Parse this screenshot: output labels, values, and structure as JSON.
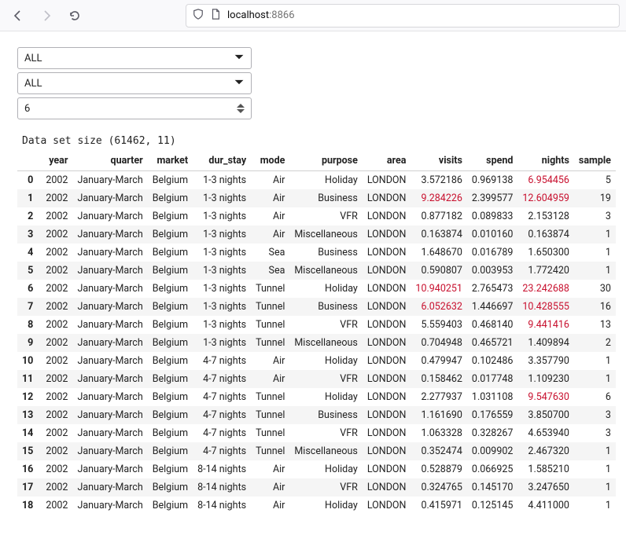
{
  "url": {
    "host": "localhost",
    "port": ":8866"
  },
  "controls": {
    "select1": "ALL",
    "select2": "ALL",
    "spinner": "6"
  },
  "size_label": "Data set size (61462, 11)",
  "columns": [
    "year",
    "quarter",
    "market",
    "dur_stay",
    "mode",
    "purpose",
    "area",
    "visits",
    "spend",
    "nights",
    "sample"
  ],
  "red_cells": {
    "0": [
      "nights"
    ],
    "1": [
      "visits",
      "nights"
    ],
    "6": [
      "visits",
      "nights"
    ],
    "7": [
      "visits",
      "nights"
    ],
    "8": [
      "nights"
    ],
    "12": [
      "nights"
    ]
  },
  "rows": [
    {
      "idx": 0,
      "year": 2002,
      "quarter": "January-March",
      "market": "Belgium",
      "dur_stay": "1-3 nights",
      "mode": "Air",
      "purpose": "Holiday",
      "area": "LONDON",
      "visits": "3.572186",
      "spend": "0.969138",
      "nights": "6.954456",
      "sample": 5
    },
    {
      "idx": 1,
      "year": 2002,
      "quarter": "January-March",
      "market": "Belgium",
      "dur_stay": "1-3 nights",
      "mode": "Air",
      "purpose": "Business",
      "area": "LONDON",
      "visits": "9.284226",
      "spend": "2.399577",
      "nights": "12.604959",
      "sample": 19
    },
    {
      "idx": 2,
      "year": 2002,
      "quarter": "January-March",
      "market": "Belgium",
      "dur_stay": "1-3 nights",
      "mode": "Air",
      "purpose": "VFR",
      "area": "LONDON",
      "visits": "0.877182",
      "spend": "0.089833",
      "nights": "2.153128",
      "sample": 3
    },
    {
      "idx": 3,
      "year": 2002,
      "quarter": "January-March",
      "market": "Belgium",
      "dur_stay": "1-3 nights",
      "mode": "Air",
      "purpose": "Miscellaneous",
      "area": "LONDON",
      "visits": "0.163874",
      "spend": "0.010160",
      "nights": "0.163874",
      "sample": 1
    },
    {
      "idx": 4,
      "year": 2002,
      "quarter": "January-March",
      "market": "Belgium",
      "dur_stay": "1-3 nights",
      "mode": "Sea",
      "purpose": "Business",
      "area": "LONDON",
      "visits": "1.648670",
      "spend": "0.016789",
      "nights": "1.650300",
      "sample": 1
    },
    {
      "idx": 5,
      "year": 2002,
      "quarter": "January-March",
      "market": "Belgium",
      "dur_stay": "1-3 nights",
      "mode": "Sea",
      "purpose": "Miscellaneous",
      "area": "LONDON",
      "visits": "0.590807",
      "spend": "0.003953",
      "nights": "1.772420",
      "sample": 1
    },
    {
      "idx": 6,
      "year": 2002,
      "quarter": "January-March",
      "market": "Belgium",
      "dur_stay": "1-3 nights",
      "mode": "Tunnel",
      "purpose": "Holiday",
      "area": "LONDON",
      "visits": "10.940251",
      "spend": "2.765473",
      "nights": "23.242688",
      "sample": 30
    },
    {
      "idx": 7,
      "year": 2002,
      "quarter": "January-March",
      "market": "Belgium",
      "dur_stay": "1-3 nights",
      "mode": "Tunnel",
      "purpose": "Business",
      "area": "LONDON",
      "visits": "6.052632",
      "spend": "1.446697",
      "nights": "10.428555",
      "sample": 16
    },
    {
      "idx": 8,
      "year": 2002,
      "quarter": "January-March",
      "market": "Belgium",
      "dur_stay": "1-3 nights",
      "mode": "Tunnel",
      "purpose": "VFR",
      "area": "LONDON",
      "visits": "5.559403",
      "spend": "0.468140",
      "nights": "9.441416",
      "sample": 13
    },
    {
      "idx": 9,
      "year": 2002,
      "quarter": "January-March",
      "market": "Belgium",
      "dur_stay": "1-3 nights",
      "mode": "Tunnel",
      "purpose": "Miscellaneous",
      "area": "LONDON",
      "visits": "0.704948",
      "spend": "0.465721",
      "nights": "1.409894",
      "sample": 2
    },
    {
      "idx": 10,
      "year": 2002,
      "quarter": "January-March",
      "market": "Belgium",
      "dur_stay": "4-7 nights",
      "mode": "Air",
      "purpose": "Holiday",
      "area": "LONDON",
      "visits": "0.479947",
      "spend": "0.102486",
      "nights": "3.357790",
      "sample": 1
    },
    {
      "idx": 11,
      "year": 2002,
      "quarter": "January-March",
      "market": "Belgium",
      "dur_stay": "4-7 nights",
      "mode": "Air",
      "purpose": "VFR",
      "area": "LONDON",
      "visits": "0.158462",
      "spend": "0.017748",
      "nights": "1.109230",
      "sample": 1
    },
    {
      "idx": 12,
      "year": 2002,
      "quarter": "January-March",
      "market": "Belgium",
      "dur_stay": "4-7 nights",
      "mode": "Tunnel",
      "purpose": "Holiday",
      "area": "LONDON",
      "visits": "2.277937",
      "spend": "1.031108",
      "nights": "9.547630",
      "sample": 6
    },
    {
      "idx": 13,
      "year": 2002,
      "quarter": "January-March",
      "market": "Belgium",
      "dur_stay": "4-7 nights",
      "mode": "Tunnel",
      "purpose": "Business",
      "area": "LONDON",
      "visits": "1.161690",
      "spend": "0.176559",
      "nights": "3.850700",
      "sample": 3
    },
    {
      "idx": 14,
      "year": 2002,
      "quarter": "January-March",
      "market": "Belgium",
      "dur_stay": "4-7 nights",
      "mode": "Tunnel",
      "purpose": "VFR",
      "area": "LONDON",
      "visits": "1.063328",
      "spend": "0.328267",
      "nights": "4.653940",
      "sample": 3
    },
    {
      "idx": 15,
      "year": 2002,
      "quarter": "January-March",
      "market": "Belgium",
      "dur_stay": "4-7 nights",
      "mode": "Tunnel",
      "purpose": "Miscellaneous",
      "area": "LONDON",
      "visits": "0.352474",
      "spend": "0.009902",
      "nights": "2.467320",
      "sample": 1
    },
    {
      "idx": 16,
      "year": 2002,
      "quarter": "January-March",
      "market": "Belgium",
      "dur_stay": "8-14 nights",
      "mode": "Air",
      "purpose": "Holiday",
      "area": "LONDON",
      "visits": "0.528879",
      "spend": "0.066925",
      "nights": "1.585210",
      "sample": 1
    },
    {
      "idx": 17,
      "year": 2002,
      "quarter": "January-March",
      "market": "Belgium",
      "dur_stay": "8-14 nights",
      "mode": "Air",
      "purpose": "VFR",
      "area": "LONDON",
      "visits": "0.324765",
      "spend": "0.145170",
      "nights": "3.247650",
      "sample": 1
    },
    {
      "idx": 18,
      "year": 2002,
      "quarter": "January-March",
      "market": "Belgium",
      "dur_stay": "8-14 nights",
      "mode": "Air",
      "purpose": "Holiday",
      "area": "LONDON",
      "visits": "0.415971",
      "spend": "0.125145",
      "nights": "4.411000",
      "sample": 1
    }
  ]
}
